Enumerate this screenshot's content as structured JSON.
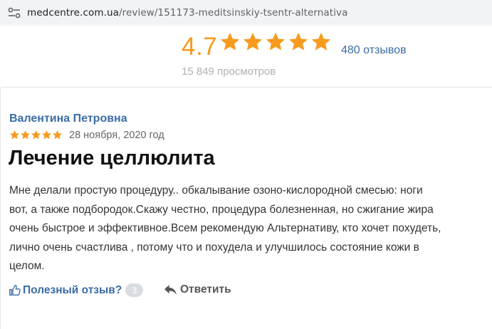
{
  "browser": {
    "url_host": "medcentre.com.ua",
    "url_path": "/review/151173-meditsinskiy-tsentr-alternativa",
    "site_info_icon": "tune-icon"
  },
  "summary": {
    "score": "4.7",
    "stars": 5,
    "reviews_count": "480 отзывов",
    "views": "15 849 просмотров",
    "star_color": "#f79b1e"
  },
  "review": {
    "author": "Валентина Петровна",
    "stars": 5,
    "date": "28 ноября, 2020 год",
    "title": "Лечение целлюлита",
    "text_lines": [
      "Мне делали простую процедуру.. обкалывание озоно-кислородной смесью: ноги",
      "вот, а также подбородок.Скажу честно, процедура болезненная, но сжигание жира",
      "очень быстрое и эффективное.Всем рекомендую Альтернативу, кто хочет похудеть,",
      "лично очень счастлива , потому что и похудела и улучшилось состояние кожи в",
      "целом."
    ],
    "useful_label": "Полезный отзыв?",
    "useful_count": "3",
    "reply_label": "Ответить",
    "link_color": "#3b6ca6"
  }
}
